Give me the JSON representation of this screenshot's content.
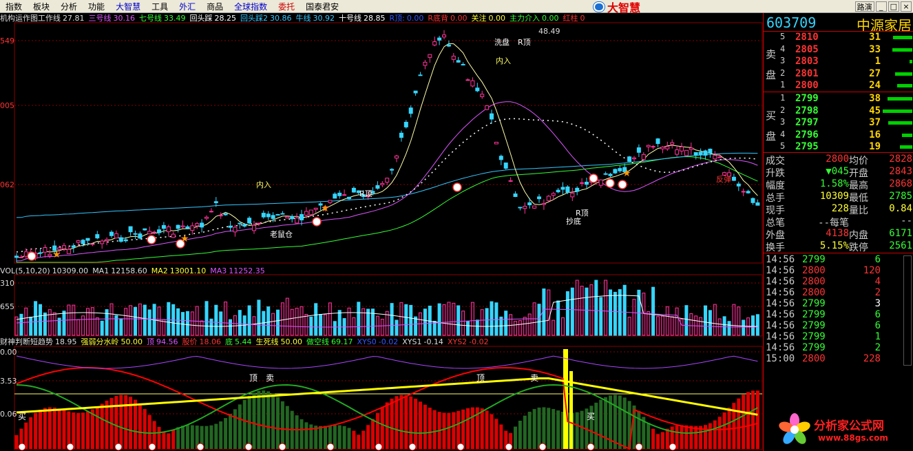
{
  "menu": [
    "指数",
    "板块",
    "分析",
    "功能",
    "大智慧",
    "工具",
    "外汇",
    "商品",
    "全球指数",
    "委托",
    "国泰君安"
  ],
  "brand": "大智慧",
  "window_buttons": [
    "路演",
    "_",
    "□",
    "×"
  ],
  "main_legend": [
    {
      "label": "机构运作图工作线",
      "value": "27.81",
      "color": "#dddddd"
    },
    {
      "label": "三号线",
      "value": "30.16",
      "color": "#dd55ff"
    },
    {
      "label": "七号线",
      "value": "33.49",
      "color": "#33ff33"
    },
    {
      "label": "回头踩",
      "value": "28.25",
      "color": "#ffffff"
    },
    {
      "label": "回头踩2",
      "value": "30.86",
      "color": "#35c7ff"
    },
    {
      "label": "牛线",
      "value": "30.92",
      "color": "#35c7ff"
    },
    {
      "label": "十号线",
      "value": "28.85",
      "color": "#ffffff"
    },
    {
      "label": "R顶:",
      "value": "0.00",
      "color": "#3355ff"
    },
    {
      "label": "R底背",
      "value": "0.00",
      "color": "#ff3333"
    },
    {
      "label": "关注",
      "value": "0.00",
      "color": "#ffff33"
    },
    {
      "label": "主力介入",
      "value": "0.00",
      "color": "#33ff33"
    },
    {
      "label": "红柱",
      "value": "0",
      "color": "#ff3333"
    }
  ],
  "price_axis": [
    "549",
    "005",
    "062"
  ],
  "price_annotations": [
    "48.49",
    "洗盘",
    "R顶",
    "内入",
    "内入",
    "老鼠仓",
    "R顶",
    "抄底",
    "R顶",
    "反弹"
  ],
  "vol_legend": [
    {
      "label": "VOL(5,10,20)",
      "value": "10309.00",
      "color": "#dddddd"
    },
    {
      "label": "MA1",
      "value": "12158.60",
      "color": "#dddddd"
    },
    {
      "label": "MA2",
      "value": "13001.10",
      "color": "#ffff33"
    },
    {
      "label": "MA3",
      "value": "11252.35",
      "color": "#dd55ff"
    }
  ],
  "vol_axis": [
    "310",
    "655"
  ],
  "ind_legend": [
    {
      "label": "财神判断短趋势",
      "value": "18.95",
      "color": "#dddddd"
    },
    {
      "label": "强弱分水岭",
      "value": "50.00",
      "color": "#ffff33"
    },
    {
      "label": "顶",
      "value": "94.56",
      "color": "#dd55ff"
    },
    {
      "label": "股价",
      "value": "18.06",
      "color": "#ff3333"
    },
    {
      "label": "底",
      "value": "5.44",
      "color": "#33ff33"
    },
    {
      "label": "生死线",
      "value": "50.00",
      "color": "#ffff33"
    },
    {
      "label": "做空线",
      "value": "69.17",
      "color": "#33ff33"
    },
    {
      "label": "XYS0",
      "value": "-0.02",
      "color": "#3355ff"
    },
    {
      "label": "XYS1",
      "value": "-0.14",
      "color": "#dddddd"
    },
    {
      "label": "XYS2",
      "value": "-0.02",
      "color": "#ff3333"
    }
  ],
  "ind_axis": [
    "0.00",
    "3.53",
    "0.06"
  ],
  "ind_annotations": [
    "顶",
    "卖",
    "顶",
    "卖",
    "买",
    "买"
  ],
  "stock": {
    "code": "603709",
    "name": "中源家居"
  },
  "asks": [
    {
      "level": "5",
      "price": "2810",
      "vol": "31",
      "bar": 0.4
    },
    {
      "level": "4",
      "price": "2805",
      "vol": "33",
      "bar": 0.42
    },
    {
      "level": "3",
      "price": "2803",
      "vol": "1",
      "bar": 0.05
    },
    {
      "level": "2",
      "price": "2801",
      "vol": "27",
      "bar": 0.35
    },
    {
      "level": "1",
      "price": "2800",
      "vol": "24",
      "bar": 0.32
    }
  ],
  "ask_label": [
    "卖",
    "盘"
  ],
  "bids": [
    {
      "level": "1",
      "price": "2799",
      "vol": "38",
      "bar": 0.52
    },
    {
      "level": "2",
      "price": "2798",
      "vol": "45",
      "bar": 0.62
    },
    {
      "level": "3",
      "price": "2797",
      "vol": "37",
      "bar": 0.5
    },
    {
      "level": "4",
      "price": "2796",
      "vol": "16",
      "bar": 0.22
    },
    {
      "level": "5",
      "price": "2795",
      "vol": "19",
      "bar": 0.26
    }
  ],
  "bid_label": [
    "买",
    "盘"
  ],
  "stats": [
    {
      "k1": "成交",
      "v1": "2800",
      "c1": "#ff3333",
      "k2": "均价",
      "v2": "2828",
      "c2": "#ff3333"
    },
    {
      "k1": "升跌",
      "v1": "▼045",
      "c1": "#33ff33",
      "k2": "开盘",
      "v2": "2843",
      "c2": "#ff3333"
    },
    {
      "k1": "幅度",
      "v1": "1.58%",
      "c1": "#33ff33",
      "k2": "最高",
      "v2": "2868",
      "c2": "#ff3333"
    },
    {
      "k1": "总手",
      "v1": "10309",
      "c1": "#ffff33",
      "k2": "最低",
      "v2": "2785",
      "c2": "#33ff33"
    },
    {
      "k1": "现手",
      "v1": "228",
      "c1": "#ffff33",
      "k2": "量比",
      "v2": "0.84",
      "c2": "#ffff33"
    },
    {
      "k1": "总笔",
      "v1": "--每笔",
      "c1": "#cccccc",
      "k2": "",
      "v2": "--",
      "c2": "#cccccc"
    },
    {
      "k1": "外盘",
      "v1": "4138",
      "c1": "#ff3333",
      "k2": "内盘",
      "v2": "6171",
      "c2": "#33ff33"
    },
    {
      "k1": "换手",
      "v1": "5.15%",
      "c1": "#ffff33",
      "k2": "跌停",
      "v2": "2561",
      "c2": "#33ff33"
    }
  ],
  "ticks": [
    {
      "time": "14:56",
      "price": "2799",
      "vol": "6",
      "pc": "#33ff33",
      "vc": "#33ff33"
    },
    {
      "time": "14:56",
      "price": "2800",
      "vol": "120",
      "pc": "#ff3333",
      "vc": "#ff3333"
    },
    {
      "time": "14:56",
      "price": "2800",
      "vol": "4",
      "pc": "#ff3333",
      "vc": "#ff3333"
    },
    {
      "time": "14:56",
      "price": "2800",
      "vol": "2",
      "pc": "#ff3333",
      "vc": "#ff3333"
    },
    {
      "time": "14:56",
      "price": "2799",
      "vol": "3",
      "pc": "#33ff33",
      "vc": "#ffffff"
    },
    {
      "time": "14:56",
      "price": "2799",
      "vol": "6",
      "pc": "#33ff33",
      "vc": "#33ff33"
    },
    {
      "time": "14:56",
      "price": "2799",
      "vol": "6",
      "pc": "#33ff33",
      "vc": "#33ff33"
    },
    {
      "time": "14:56",
      "price": "2799",
      "vol": "1",
      "pc": "#33ff33",
      "vc": "#33ff33"
    },
    {
      "time": "14:56",
      "price": "2799",
      "vol": "2",
      "pc": "#33ff33",
      "vc": "#33ff33"
    },
    {
      "time": "15:00",
      "price": "2800",
      "vol": "228",
      "pc": "#ff3333",
      "vc": "#ff3333"
    }
  ],
  "watermark": {
    "title": "分析家公式网",
    "url": "www.88gs.com"
  }
}
